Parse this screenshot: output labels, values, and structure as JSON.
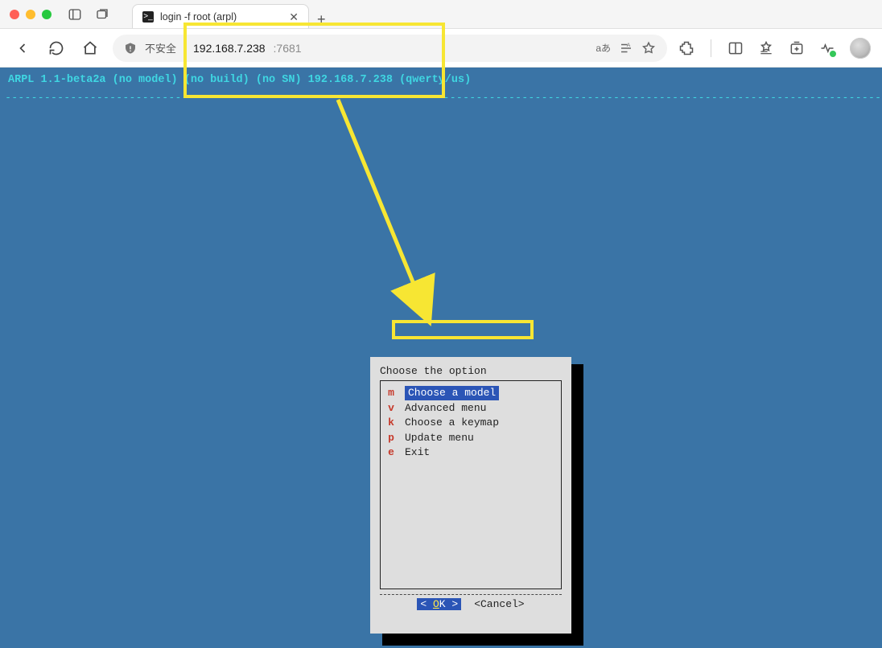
{
  "window": {
    "tab_title": "login -f root (arpl)"
  },
  "toolbar": {
    "secure_label": "不安全",
    "url_host": "192.168.7.238",
    "url_port": ":7681",
    "translate_label": "aあ"
  },
  "terminal": {
    "status_line": "ARPL 1.1-beta2a (no model) (no build) (no SN) 192.168.7.238 (qwerty/us)"
  },
  "dialog": {
    "title": "Choose the option",
    "items": [
      {
        "key": "m",
        "label": "Choose a model",
        "selected": true
      },
      {
        "key": "v",
        "label": "Advanced menu",
        "selected": false
      },
      {
        "key": "k",
        "label": "Choose a keymap",
        "selected": false
      },
      {
        "key": "p",
        "label": "Update menu",
        "selected": false
      },
      {
        "key": "e",
        "label": "Exit",
        "selected": false
      }
    ],
    "ok_label_open": "<  ",
    "ok_hot": "O",
    "ok_rest": "K",
    "ok_label_close": "  >",
    "cancel_label": "<Cancel>"
  }
}
